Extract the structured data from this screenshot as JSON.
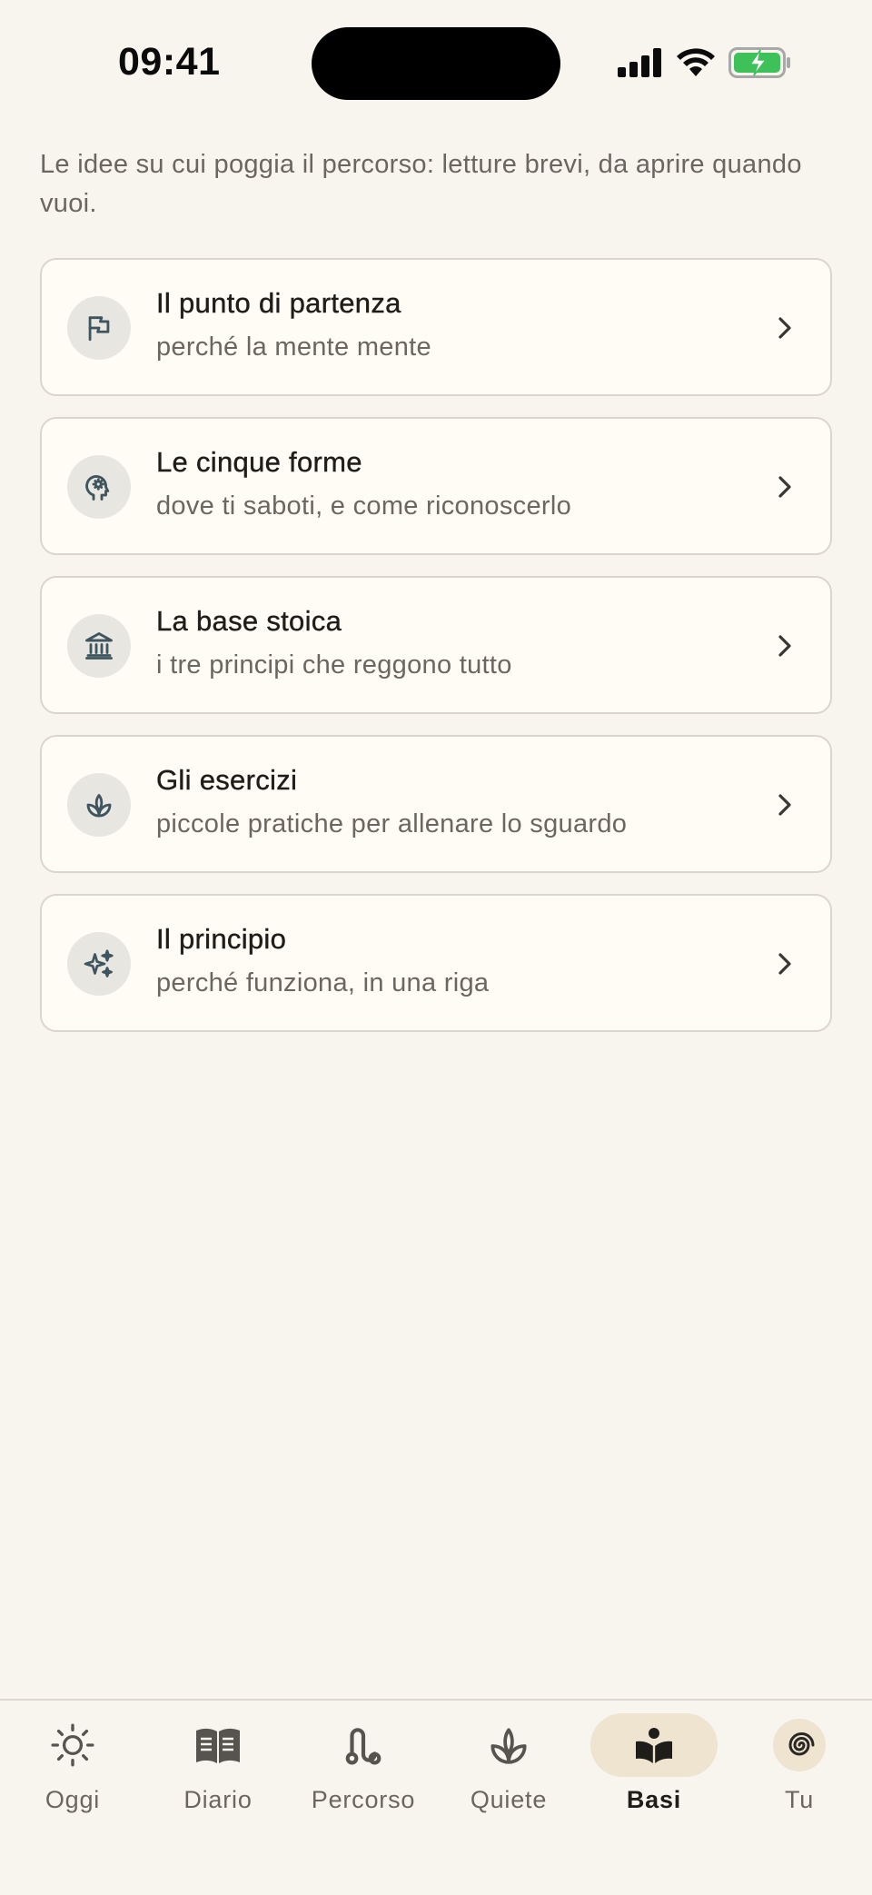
{
  "status_bar": {
    "time": "09:41"
  },
  "intro_text": "Le idee su cui poggia il percorso: letture brevi, da aprire quando vuoi.",
  "cards": [
    {
      "title": "Il punto di partenza",
      "subtitle": "perché la mente mente",
      "icon": "flag-icon"
    },
    {
      "title": "Le cinque forme",
      "subtitle": "dove ti saboti, e come riconoscerlo",
      "icon": "head-gear-icon"
    },
    {
      "title": "La base stoica",
      "subtitle": "i tre principi che reggono tutto",
      "icon": "temple-icon"
    },
    {
      "title": "Gli esercizi",
      "subtitle": "piccole pratiche per allenare lo sguardo",
      "icon": "sprout-icon"
    },
    {
      "title": "Il principio",
      "subtitle": "perché funziona, in una riga",
      "icon": "sparkles-icon"
    }
  ],
  "tabs": [
    {
      "label": "Oggi",
      "icon": "sun-icon",
      "active": false
    },
    {
      "label": "Diario",
      "icon": "book-icon",
      "active": false
    },
    {
      "label": "Percorso",
      "icon": "route-icon",
      "active": false
    },
    {
      "label": "Quiete",
      "icon": "sprout-icon",
      "active": false
    },
    {
      "label": "Basi",
      "icon": "book-reader-icon",
      "active": true
    },
    {
      "label": "Tu",
      "icon": "spiral-icon",
      "active": false
    }
  ],
  "colors": {
    "background": "#F8F4EE",
    "card_background": "#FFFCF5",
    "icon_color": "#3E5560",
    "active_tab_background": "#EFE4D0",
    "battery_green": "#3FC15A"
  }
}
